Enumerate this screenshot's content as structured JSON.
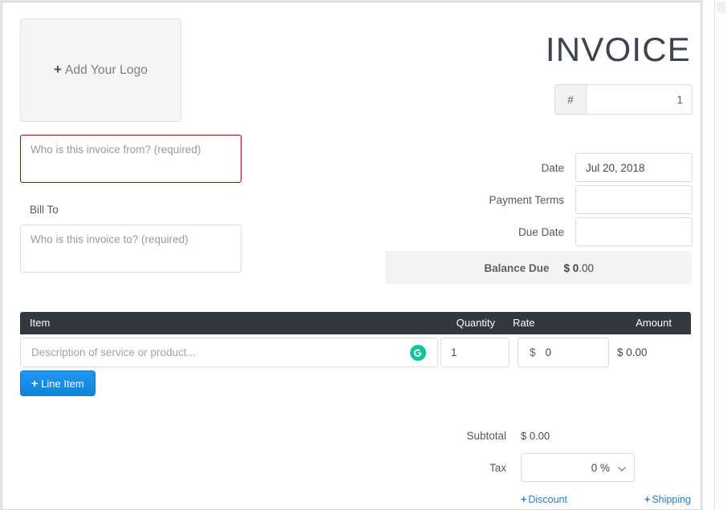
{
  "document": {
    "title": "INVOICE"
  },
  "logo": {
    "plus": "+",
    "label": "Add Your Logo"
  },
  "sender": {
    "placeholder": "Who is this invoice from? (required)",
    "value": "",
    "required": true,
    "error_border_color": "#8e1010"
  },
  "bill_to": {
    "label": "Bill To",
    "placeholder": "Who is this invoice to? (required)",
    "value": "",
    "required": true
  },
  "invoice_number": {
    "prefix": "#",
    "value": "1"
  },
  "meta": [
    {
      "label": "Date",
      "value": "Jul 20, 2018",
      "placeholder": ""
    },
    {
      "label": "Payment Terms",
      "value": "",
      "placeholder": ""
    },
    {
      "label": "Due Date",
      "value": "",
      "placeholder": ""
    }
  ],
  "balance_due": {
    "label": "Balance Due",
    "currency_and_major": "$ 0",
    "minor": ".00"
  },
  "items_table": {
    "columns": {
      "item": "Item",
      "quantity": "Quantity",
      "rate": "Rate",
      "amount": "Amount"
    },
    "header_bg": "#32383f",
    "rows": [
      {
        "description_placeholder": "Description of service or product...",
        "description_value": "",
        "quantity": "1",
        "rate_currency": "$",
        "rate": "0",
        "amount": "$ 0.00",
        "assistant_icon": "grammarly-icon"
      }
    ]
  },
  "add_line_item": {
    "plus": "+",
    "label": "Line Item",
    "color": "#1183d8"
  },
  "totals": {
    "subtotal_label": "Subtotal",
    "subtotal_value": "$ 0.00",
    "tax_label": "Tax",
    "tax_value": "0 %",
    "tax_caret": "chevron-down-icon"
  },
  "addons": [
    {
      "plus": "+",
      "label": "Discount"
    },
    {
      "plus": "+",
      "label": "Shipping"
    }
  ],
  "colors": {
    "accent_blue": "#2a7fc9",
    "button_blue": "#1183d8",
    "table_header": "#32383f",
    "error_red": "#8e1010",
    "grammarly_green": "#15c39a"
  }
}
